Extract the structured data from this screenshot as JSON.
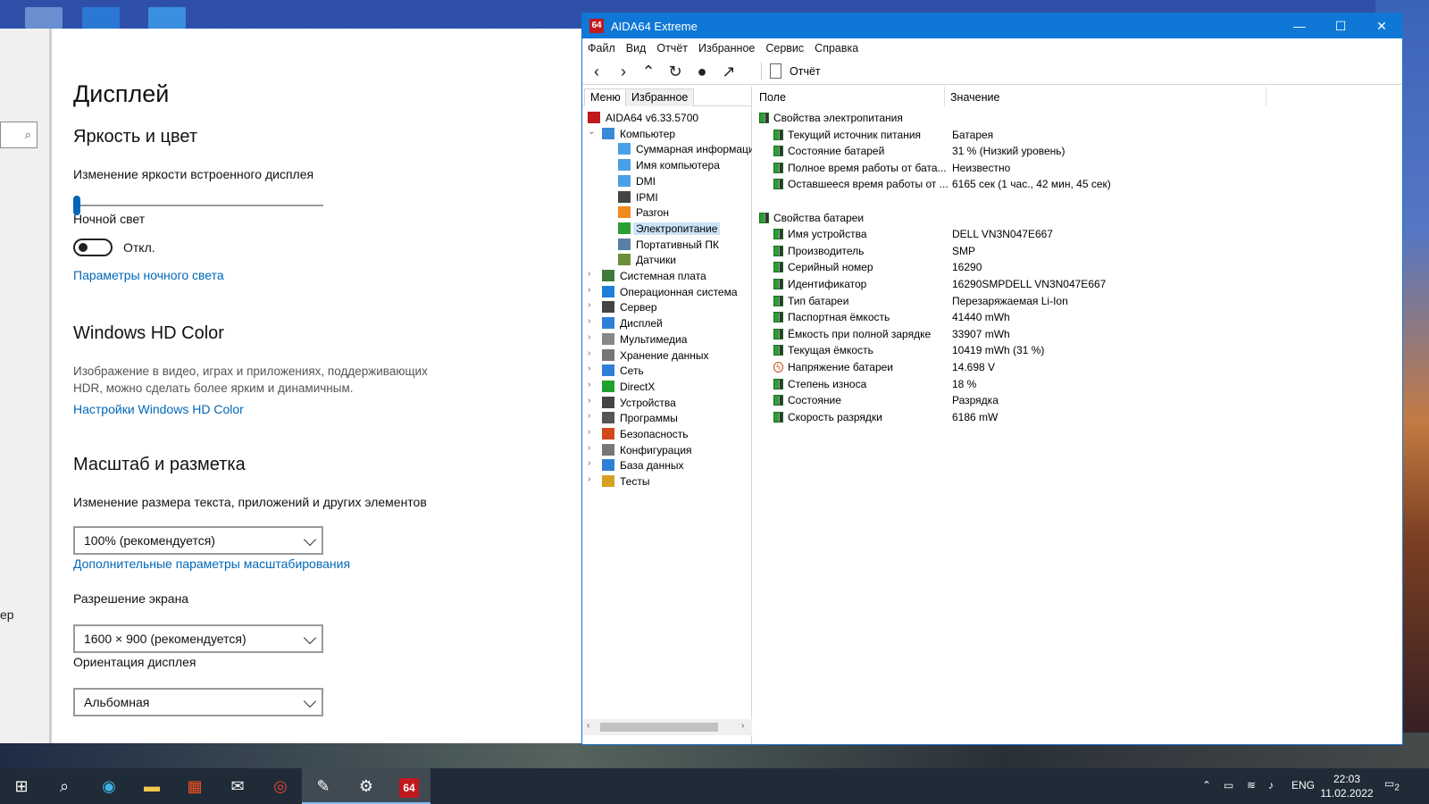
{
  "settings": {
    "nav_text": "ер",
    "title": "Дисплей",
    "brightness_section": "Яркость и цвет",
    "brightness_label": "Изменение яркости встроенного дисплея",
    "night_light_label": "Ночной свет",
    "night_light_state": "Откл.",
    "night_light_link": "Параметры ночного света",
    "hdr_section": "Windows HD Color",
    "hdr_desc": "Изображение в видео, играх и приложениях, поддерживающих HDR, можно сделать более ярким и динамичным.",
    "hdr_link": "Настройки Windows HD Color",
    "scale_section": "Масштаб и разметка",
    "scale_label": "Изменение размера текста, приложений и других элементов",
    "scale_value": "100% (рекомендуется)",
    "scale_link": "Дополнительные параметры масштабирования",
    "resolution_label": "Разрешение экрана",
    "resolution_value": "1600 × 900 (рекомендуется)",
    "orientation_label": "Ориентация дисплея",
    "orientation_value": "Альбомная"
  },
  "aida": {
    "title": "AIDA64 Extreme",
    "logo": "64",
    "menu": [
      "Файл",
      "Вид",
      "Отчёт",
      "Избранное",
      "Сервис",
      "Справка"
    ],
    "toolbar_report": "Отчёт",
    "tabs": [
      "Меню",
      "Избранное"
    ],
    "tree": [
      {
        "label": "AIDA64 v6.33.5700",
        "level": 0,
        "icon": "aida-logo-icon"
      },
      {
        "label": "Компьютер",
        "level": 0,
        "icon": "computer-icon",
        "expanded": true
      },
      {
        "label": "Суммарная информация",
        "level": 1,
        "icon": "monitor-icon"
      },
      {
        "label": "Имя компьютера",
        "level": 1,
        "icon": "monitor-icon"
      },
      {
        "label": "DMI",
        "level": 1,
        "icon": "monitor-icon"
      },
      {
        "label": "IPMI",
        "level": 1,
        "icon": "server-icon"
      },
      {
        "label": "Разгон",
        "level": 1,
        "icon": "flame-icon"
      },
      {
        "label": "Электропитание",
        "level": 1,
        "icon": "battery-icon",
        "selected": true
      },
      {
        "label": "Портативный ПК",
        "level": 1,
        "icon": "laptop-icon"
      },
      {
        "label": "Датчики",
        "level": 1,
        "icon": "gauge-icon"
      },
      {
        "label": "Системная плата",
        "level": 0,
        "icon": "motherboard-icon"
      },
      {
        "label": "Операционная система",
        "level": 0,
        "icon": "windows-icon"
      },
      {
        "label": "Сервер",
        "level": 0,
        "icon": "server-icon"
      },
      {
        "label": "Дисплей",
        "level": 0,
        "icon": "display-icon"
      },
      {
        "label": "Мультимедиа",
        "level": 0,
        "icon": "speaker-icon"
      },
      {
        "label": "Хранение данных",
        "level": 0,
        "icon": "storage-icon"
      },
      {
        "label": "Сеть",
        "level": 0,
        "icon": "network-icon"
      },
      {
        "label": "DirectX",
        "level": 0,
        "icon": "xbox-icon"
      },
      {
        "label": "Устройства",
        "level": 0,
        "icon": "devices-icon"
      },
      {
        "label": "Программы",
        "level": 0,
        "icon": "programs-icon"
      },
      {
        "label": "Безопасность",
        "level": 0,
        "icon": "shield-icon"
      },
      {
        "label": "Конфигурация",
        "level": 0,
        "icon": "config-icon"
      },
      {
        "label": "База данных",
        "level": 0,
        "icon": "database-icon"
      },
      {
        "label": "Тесты",
        "level": 0,
        "icon": "tests-icon"
      }
    ],
    "columns": [
      "Поле",
      "Значение"
    ],
    "rows": [
      {
        "type": "group",
        "field": "Свойства электропитания"
      },
      {
        "type": "item",
        "field": "Текущий источник питания",
        "value": "Батарея",
        "icon": "battery"
      },
      {
        "type": "item",
        "field": "Состояние батарей",
        "value": "31 % (Низкий уровень)",
        "icon": "battery"
      },
      {
        "type": "item",
        "field": "Полное время работы от бата...",
        "value": "Неизвестно",
        "icon": "battery"
      },
      {
        "type": "item",
        "field": "Оставшееся время работы от ...",
        "value": "6165 сек (1 час., 42 мин, 45 сек)",
        "icon": "battery"
      },
      {
        "type": "gap"
      },
      {
        "type": "group",
        "field": "Свойства батареи"
      },
      {
        "type": "item",
        "field": "Имя устройства",
        "value": "DELL VN3N047E667",
        "icon": "battery"
      },
      {
        "type": "item",
        "field": "Производитель",
        "value": "SMP",
        "icon": "battery"
      },
      {
        "type": "item",
        "field": "Серийный номер",
        "value": "16290",
        "icon": "battery"
      },
      {
        "type": "item",
        "field": "Идентификатор",
        "value": "16290SMPDELL VN3N047E667",
        "icon": "battery"
      },
      {
        "type": "item",
        "field": "Тип батареи",
        "value": "Перезаряжаемая Li-Ion",
        "icon": "battery"
      },
      {
        "type": "item",
        "field": "Паспортная ёмкость",
        "value": "41440 mWh",
        "icon": "battery"
      },
      {
        "type": "item",
        "field": "Ёмкость при полной зарядке",
        "value": "33907 mWh",
        "icon": "battery"
      },
      {
        "type": "item",
        "field": "Текущая ёмкость",
        "value": "10419 mWh  (31 %)",
        "icon": "battery"
      },
      {
        "type": "item",
        "field": "Напряжение батареи",
        "value": "14.698 V",
        "icon": "bolt"
      },
      {
        "type": "item",
        "field": "Степень износа",
        "value": "18 %",
        "icon": "battery"
      },
      {
        "type": "item",
        "field": "Состояние",
        "value": "Разрядка",
        "icon": "battery"
      },
      {
        "type": "item",
        "field": "Скорость разрядки",
        "value": "6186 mW",
        "icon": "battery"
      }
    ]
  },
  "taskbar": {
    "lang": "ENG",
    "time": "22:03",
    "date": "11.02.2022",
    "notifications": "2",
    "aida_label": "64"
  }
}
